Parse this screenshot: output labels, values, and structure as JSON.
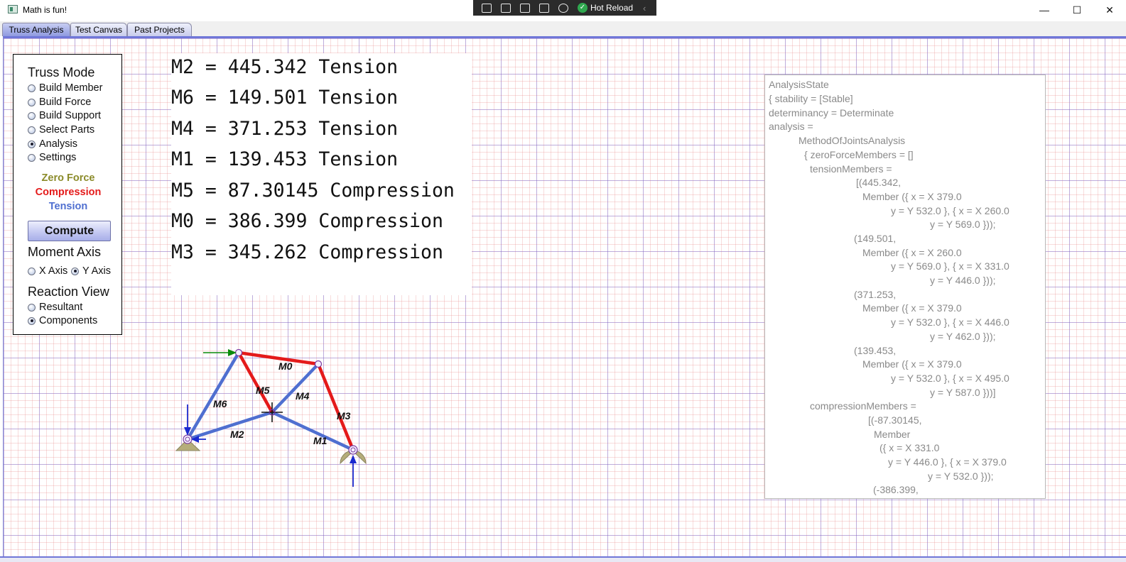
{
  "window": {
    "title": "Math is fun!",
    "minimize_glyph": "—",
    "maximize_glyph": "☐",
    "close_glyph": "✕"
  },
  "debug_toolbar": {
    "hot_reload_label": "Hot Reload",
    "icons": [
      "live-visual-tree-icon",
      "select-element-icon",
      "display-layout-adorners-icon",
      "track-focus-icon",
      "binding-failures-icon"
    ],
    "check_glyph": "✓",
    "collapse_glyph": "‹"
  },
  "tabs": [
    {
      "label": "Truss Analysis",
      "active": true
    },
    {
      "label": "Test Canvas",
      "active": false
    },
    {
      "label": "Past Projects",
      "active": false
    }
  ],
  "mode_panel": {
    "heading": "Truss Mode",
    "options": [
      {
        "label": "Build Member",
        "checked": false
      },
      {
        "label": "Build Force",
        "checked": false
      },
      {
        "label": "Build Support",
        "checked": false
      },
      {
        "label": "Select Parts",
        "checked": false
      },
      {
        "label": "Analysis",
        "checked": true
      },
      {
        "label": "Settings",
        "checked": false
      }
    ],
    "legend": {
      "zero_force": "Zero Force",
      "compression": "Compression",
      "tension": "Tension"
    },
    "compute_label": "Compute",
    "moment_axis": {
      "heading": "Moment Axis",
      "options": [
        {
          "label": "X Axis",
          "checked": false
        },
        {
          "label": "Y Axis",
          "checked": true
        }
      ]
    },
    "reaction_view": {
      "heading": "Reaction View",
      "options": [
        {
          "label": "Resultant",
          "checked": false
        },
        {
          "label": "Components",
          "checked": true
        }
      ]
    }
  },
  "colors": {
    "zero_force": "#8b8b2a",
    "compression": "#e41a1a",
    "tension": "#4f6fd0",
    "accent": "#6f76d8"
  },
  "results": [
    "M2 = 445.342 Tension",
    "M6 = 149.501 Tension",
    "M4 = 371.253 Tension",
    "M1 = 139.453 Tension",
    "M5 = 87.30145 Compression",
    "M0 = 386.399 Compression",
    "M3 = 345.262 Compression"
  ],
  "truss": {
    "members": [
      {
        "name": "M0",
        "type": "compression"
      },
      {
        "name": "M1",
        "type": "tension"
      },
      {
        "name": "M2",
        "type": "tension"
      },
      {
        "name": "M3",
        "type": "compression"
      },
      {
        "name": "M4",
        "type": "tension"
      },
      {
        "name": "M5",
        "type": "compression"
      },
      {
        "name": "M6",
        "type": "tension"
      }
    ]
  },
  "analysis_state": [
    "AnalysisState",
    "  { stability = [Stable]",
    "    determinancy = Determinate",
    "    analysis =",
    "      MethodOfJointsAnalysis",
    "        { zeroForceMembers = []",
    "          tensionMembers =",
    "            [(445.342,",
    "              Member ({ x = X 379.0",
    "                y = Y 532.0 }, { x = X 260.0",
    "                  y = Y 569.0 }));",
    "            (149.501,",
    "              Member ({ x = X 260.0",
    "                y = Y 569.0 }, { x = X 331.0",
    "                  y = Y 446.0 }));",
    "            (371.253,",
    "              Member ({ x = X 379.0",
    "                y = Y 532.0 }, { x = X 446.0",
    "                  y = Y 462.0 }));",
    "            (139.453,",
    "              Member ({ x = X 379.0",
    "                y = Y 532.0 }, { x = X 495.0",
    "                  y = Y 587.0 }))]",
    "          compressionMembers =",
    "            [(-87.30145,",
    "              Member",
    "                ({ x = X 331.0",
    "                  y = Y 446.0 }, { x = X 379.0",
    "                    y = Y 532.0 }));",
    "            (-386.399,"
  ]
}
